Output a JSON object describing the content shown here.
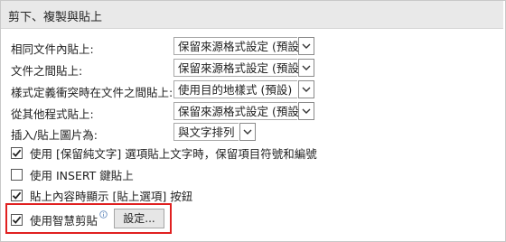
{
  "section": {
    "title": "剪下、複製與貼上"
  },
  "settings": [
    {
      "label": "相同文件內貼上:",
      "value": "保留來源格式設定 (預設)"
    },
    {
      "label": "文件之間貼上:",
      "value": "保留來源格式設定 (預設)"
    },
    {
      "label": "樣式定義衝突時在文件之間貼上:",
      "value": "使用目的地樣式 (預設)"
    },
    {
      "label": "從其他程式貼上:",
      "value": "保留來源格式設定 (預設)"
    },
    {
      "label": "插入/貼上圖片為:",
      "value": "與文字排列"
    }
  ],
  "checkboxes": [
    {
      "label": "使用 [保留純文字] 選項貼上文字時，保留項目符號和編號",
      "checked": true
    },
    {
      "label": "使用 INSERT 鍵貼上",
      "checked": false
    },
    {
      "label": "貼上內容時顯示 [貼上選項] 按鈕",
      "checked": true
    },
    {
      "label": "使用智慧剪貼",
      "checked": true
    }
  ],
  "smart_cut": {
    "info_icon": "info-icon",
    "settings_button": "設定..."
  },
  "highlight_color": "#e02020"
}
